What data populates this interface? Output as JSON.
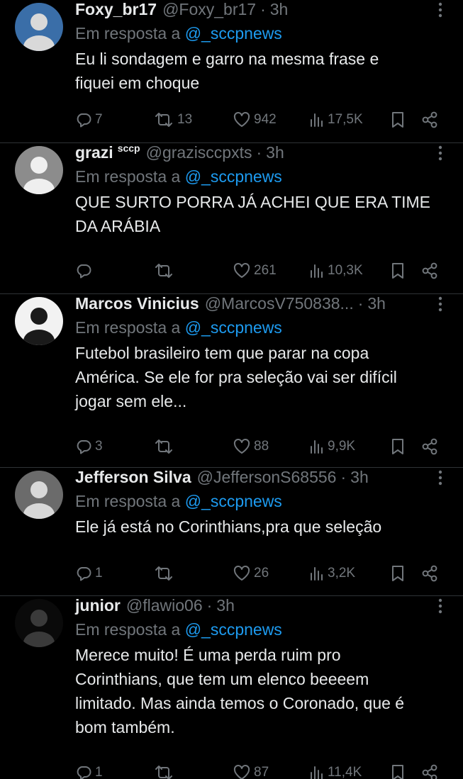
{
  "reply_prefix": "Em resposta a",
  "tweets": [
    {
      "name": "Foxy_br17",
      "badge": "",
      "handle": "@Foxy_br17",
      "time": "3h",
      "reply_to": "@_sccpnews",
      "text": "Eu li sondagem e garro na mesma frase e\nfiquei em choque",
      "replies": "7",
      "retweets": "13",
      "likes": "942",
      "views": "17,5K",
      "avatar_colors": [
        "#3a6ea8",
        "#d9d9d9"
      ]
    },
    {
      "name": "grazi",
      "badge": "sccp",
      "handle": "@grazisccpxts",
      "time": "3h",
      "reply_to": "@_sccpnews",
      "text": "QUE SURTO PORRA JÁ ACHEI QUE ERA TIME\nDA ARÁBIA",
      "replies": "",
      "retweets": "",
      "likes": "261",
      "views": "10,3K",
      "avatar_colors": [
        "#8c8c8c",
        "#efefef"
      ]
    },
    {
      "name": "Marcos Vinicius",
      "badge": "",
      "handle": "@MarcosV750838...",
      "time": "3h",
      "reply_to": "@_sccpnews",
      "text": "Futebol brasileiro tem que parar na copa\nAmérica. Se ele for pra seleção vai ser difícil\njogar sem ele...",
      "replies": "3",
      "retweets": "",
      "likes": "88",
      "views": "9,9K",
      "avatar_colors": [
        "#f2f2f2",
        "#1a1a1a"
      ]
    },
    {
      "name": "Jefferson Silva",
      "badge": "",
      "handle": "@JeffersonS68556",
      "time": "3h",
      "reply_to": "@_sccpnews",
      "text": "Ele já está no Corinthians,pra que seleção",
      "replies": "1",
      "retweets": "",
      "likes": "26",
      "views": "3,2K",
      "avatar_colors": [
        "#6b6b6b",
        "#d8d8d8"
      ]
    },
    {
      "name": "junior",
      "badge": "",
      "handle": "@flawio06",
      "time": "3h",
      "reply_to": "@_sccpnews",
      "text": "Merece muito! É uma perda ruim pro\nCorinthians, que tem um elenco beeeem\nlimitado. Mas ainda temos o Coronado, que é\nbom também.",
      "replies": "1",
      "retweets": "",
      "likes": "87",
      "views": "11,4K",
      "avatar_colors": [
        "#0a0a0a",
        "#3a3a3a"
      ]
    }
  ]
}
